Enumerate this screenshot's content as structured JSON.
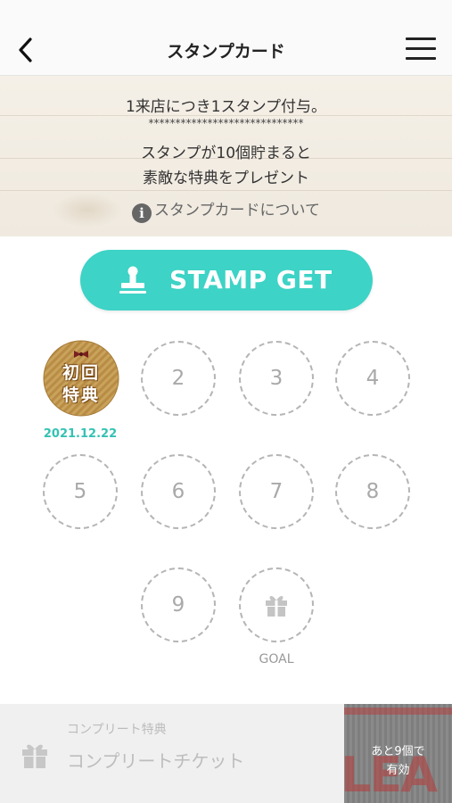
{
  "header": {
    "title": "スタンプカード"
  },
  "info": {
    "line1": "1来店につき1スタンプ付与。",
    "separator": "*****************************",
    "line2": "スタンプが10個貯まると",
    "line3": "素敵な特典をプレゼント",
    "about_link": "スタンプカードについて",
    "info_glyph": "i"
  },
  "stamp_button": {
    "label": "STAMP GET"
  },
  "stamps": {
    "first": {
      "badge_text": "初回\n特典",
      "badge_line1": "初回",
      "badge_line2": "特典",
      "date": "2021.12.22"
    },
    "slots": [
      "2",
      "3",
      "4",
      "5",
      "6",
      "7",
      "8",
      "9"
    ],
    "goal_label": "GOAL"
  },
  "complete": {
    "small_label": "コンプリート特典",
    "main_label": "コンプリートチケット",
    "ticket_line1": "あと9個で",
    "ticket_line2": "有効",
    "ticket_deco": "LEA"
  },
  "colors": {
    "accent": "#3dd3c6",
    "date": "#33c2b3",
    "slot_border": "#b5b5b5"
  }
}
